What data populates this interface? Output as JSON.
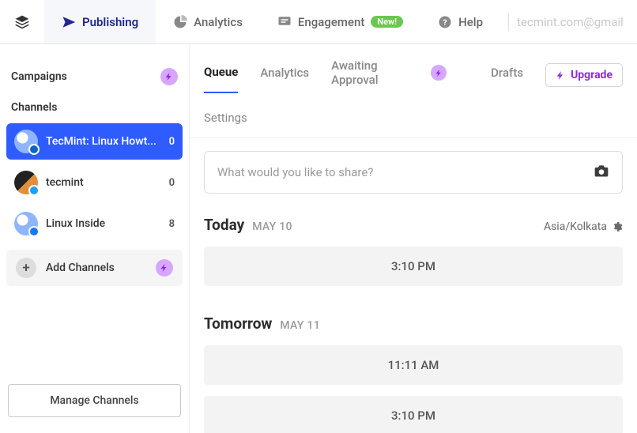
{
  "topnav": {
    "items": [
      {
        "label": "Publishing"
      },
      {
        "label": "Analytics"
      },
      {
        "label": "Engagement",
        "badge": "New!"
      },
      {
        "label": "Help"
      }
    ],
    "email": "tecmint.com@gmail"
  },
  "sidebar": {
    "campaigns_label": "Campaigns",
    "channels_label": "Channels",
    "channels": [
      {
        "label": "TecMint: Linux Howt...",
        "count": "0",
        "network": "linkedin"
      },
      {
        "label": "tecmint",
        "count": "0",
        "network": "twitter"
      },
      {
        "label": "Linux Inside",
        "count": "8",
        "network": "facebook"
      }
    ],
    "add_channels_label": "Add Channels",
    "manage_channels_label": "Manage Channels"
  },
  "main": {
    "tabs": [
      {
        "label": "Queue"
      },
      {
        "label": "Analytics"
      },
      {
        "label": "Awaiting Approval"
      },
      {
        "label": "Drafts"
      }
    ],
    "upgrade_label": "Upgrade",
    "subtab_label": "Settings",
    "composer_placeholder": "What would you like to share?",
    "sections": [
      {
        "title": "Today",
        "date": "MAY 10",
        "timezone": "Asia/Kolkata",
        "slots": [
          "3:10 PM"
        ]
      },
      {
        "title": "Tomorrow",
        "date": "MAY 11",
        "slots": [
          "11:11 AM",
          "3:10 PM"
        ]
      }
    ]
  }
}
